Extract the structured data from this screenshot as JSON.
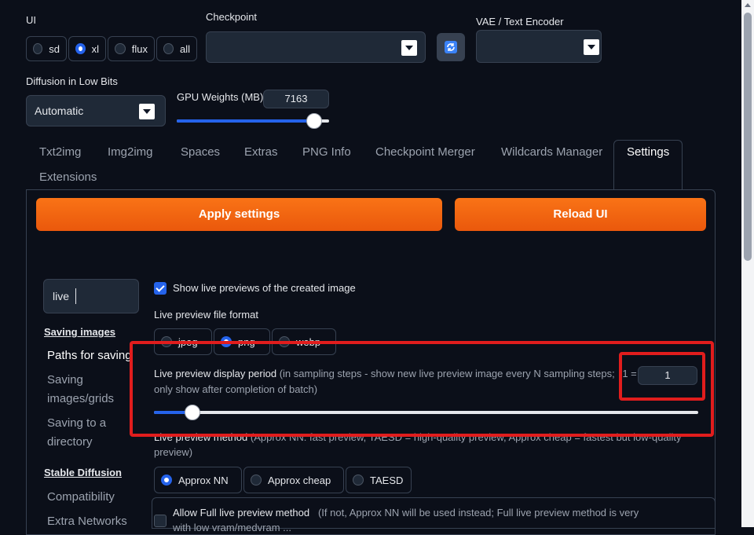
{
  "top": {
    "ui_label": "UI",
    "ui_options": [
      {
        "label": "sd",
        "selected": false
      },
      {
        "label": "xl",
        "selected": true
      },
      {
        "label": "flux",
        "selected": false
      },
      {
        "label": "all",
        "selected": false
      }
    ],
    "checkpoint_label": "Checkpoint",
    "checkpoint_value": "",
    "refresh_icon": "refresh-icon",
    "vae_label": "VAE / Text Encoder",
    "vae_value": "",
    "diffusion_label": "Diffusion in Low Bits",
    "diffusion_value": "Automatic",
    "gpu_label": "GPU Weights (MB)",
    "gpu_value": "7163",
    "gpu_fraction": 0.9
  },
  "tabs": [
    "Txt2img",
    "Img2img",
    "Spaces",
    "Extras",
    "PNG Info",
    "Checkpoint Merger",
    "Wildcards Manager",
    "Settings",
    "Extensions"
  ],
  "active_tab": "Settings",
  "settings": {
    "apply_label": "Apply settings",
    "reload_label": "Reload UI",
    "search_value": "live",
    "sidebar": {
      "section1": "Saving images",
      "items1": [
        "Paths for saving",
        "Saving images/grids",
        "Saving to a directory"
      ],
      "section2": "Stable Diffusion",
      "items2": [
        "Compatibility",
        "Extra Networks"
      ]
    },
    "show_live_previews": {
      "label": "Show live previews of the created image",
      "checked": true
    },
    "file_format": {
      "label": "Live preview file format",
      "options": [
        {
          "label": "jpeg",
          "selected": false
        },
        {
          "label": "png",
          "selected": true
        },
        {
          "label": "webp",
          "selected": false
        }
      ]
    },
    "display_period": {
      "label": "Live preview display period",
      "hint_line1": "(in sampling steps - show new live preview image every N sampling steps;",
      "hint_eq": "-1 =",
      "hint_line2": "only show after completion of batch)",
      "value": "1",
      "fraction": 0.07
    },
    "method": {
      "label": "Live preview method",
      "hint_line1": "(Approx NN: fast preview, TAESD = high-quality preview, Approx cheap = fastest but low-quality",
      "hint_line2": "preview)",
      "options": [
        {
          "label": "Approx NN",
          "selected": true
        },
        {
          "label": "Approx cheap",
          "selected": false
        },
        {
          "label": "TAESD",
          "selected": false
        }
      ]
    },
    "full_method": {
      "label": "Allow Full live preview method",
      "hint_line1": "(If not, Approx NN will be used instead; Full live preview method is very",
      "hint_line2": "with low vram/medvram ...",
      "checked": false
    }
  },
  "colors": {
    "accent": "#2563eb",
    "orange": "#f97316",
    "highlight": "#e11d1d",
    "bg": "#0b0f19"
  }
}
